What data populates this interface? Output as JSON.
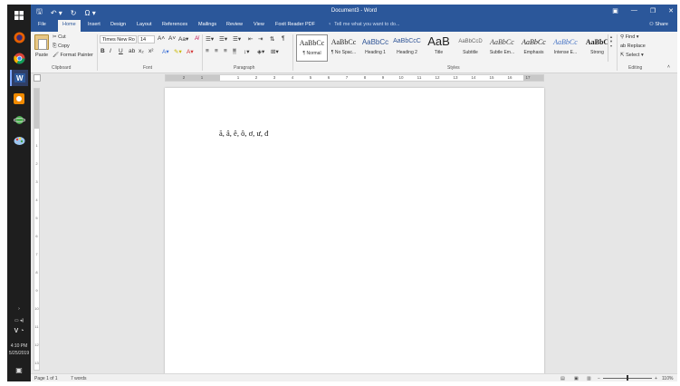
{
  "taskbar": {
    "time": "4:10 PM",
    "date": "5/25/2019",
    "icons": [
      "windows-start-icon",
      "firefox-icon",
      "chrome-icon",
      "word-icon",
      "orange-app-icon",
      "planet-app-icon",
      "paint-icon"
    ]
  },
  "window": {
    "title": "Document3 - Word",
    "quick_access": [
      "save-icon",
      "undo-icon",
      "redo-icon",
      "omega-icon"
    ]
  },
  "tabs": [
    "File",
    "Home",
    "Insert",
    "Design",
    "Layout",
    "References",
    "Mailings",
    "Review",
    "View",
    "Foxit Reader PDF"
  ],
  "active_tab": "Home",
  "tell_me": "Tell me what you want to do...",
  "sign_in": "Share",
  "ribbon": {
    "clipboard": {
      "paste": "Paste",
      "cut": "Cut",
      "copy": "Copy",
      "format_painter": "Format Painter",
      "label": "Clipboard"
    },
    "font": {
      "font_name": "Times New Ro",
      "font_size": "14",
      "label": "Font",
      "bold": "B",
      "italic": "I",
      "underline": "U"
    },
    "paragraph": {
      "label": "Paragraph"
    },
    "styles": {
      "label": "Styles",
      "items": [
        {
          "preview": "AaBbCc",
          "name": "¶ Normal"
        },
        {
          "preview": "AaBbCc",
          "name": "¶ No Spac..."
        },
        {
          "preview": "AaBbCc",
          "name": "Heading 1"
        },
        {
          "preview": "AaBbCcC",
          "name": "Heading 2"
        },
        {
          "preview": "AaB",
          "name": "Title"
        },
        {
          "preview": "AaBbCcD",
          "name": "Subtitle"
        },
        {
          "preview": "AaBbCc",
          "name": "Subtle Em..."
        },
        {
          "preview": "AaBbCc",
          "name": "Emphasis"
        },
        {
          "preview": "AaBbCc",
          "name": "Intense E..."
        },
        {
          "preview": "AaBbC",
          "name": "Strong"
        }
      ]
    },
    "editing": {
      "find": "Find",
      "replace": "Replace",
      "select": "Select",
      "label": "Editing"
    }
  },
  "document": {
    "text": "ă, â, ê, ô, ơ, ư, đ"
  },
  "status": {
    "page": "Page 1 of 1",
    "words": "7 words",
    "zoom": "110%"
  }
}
